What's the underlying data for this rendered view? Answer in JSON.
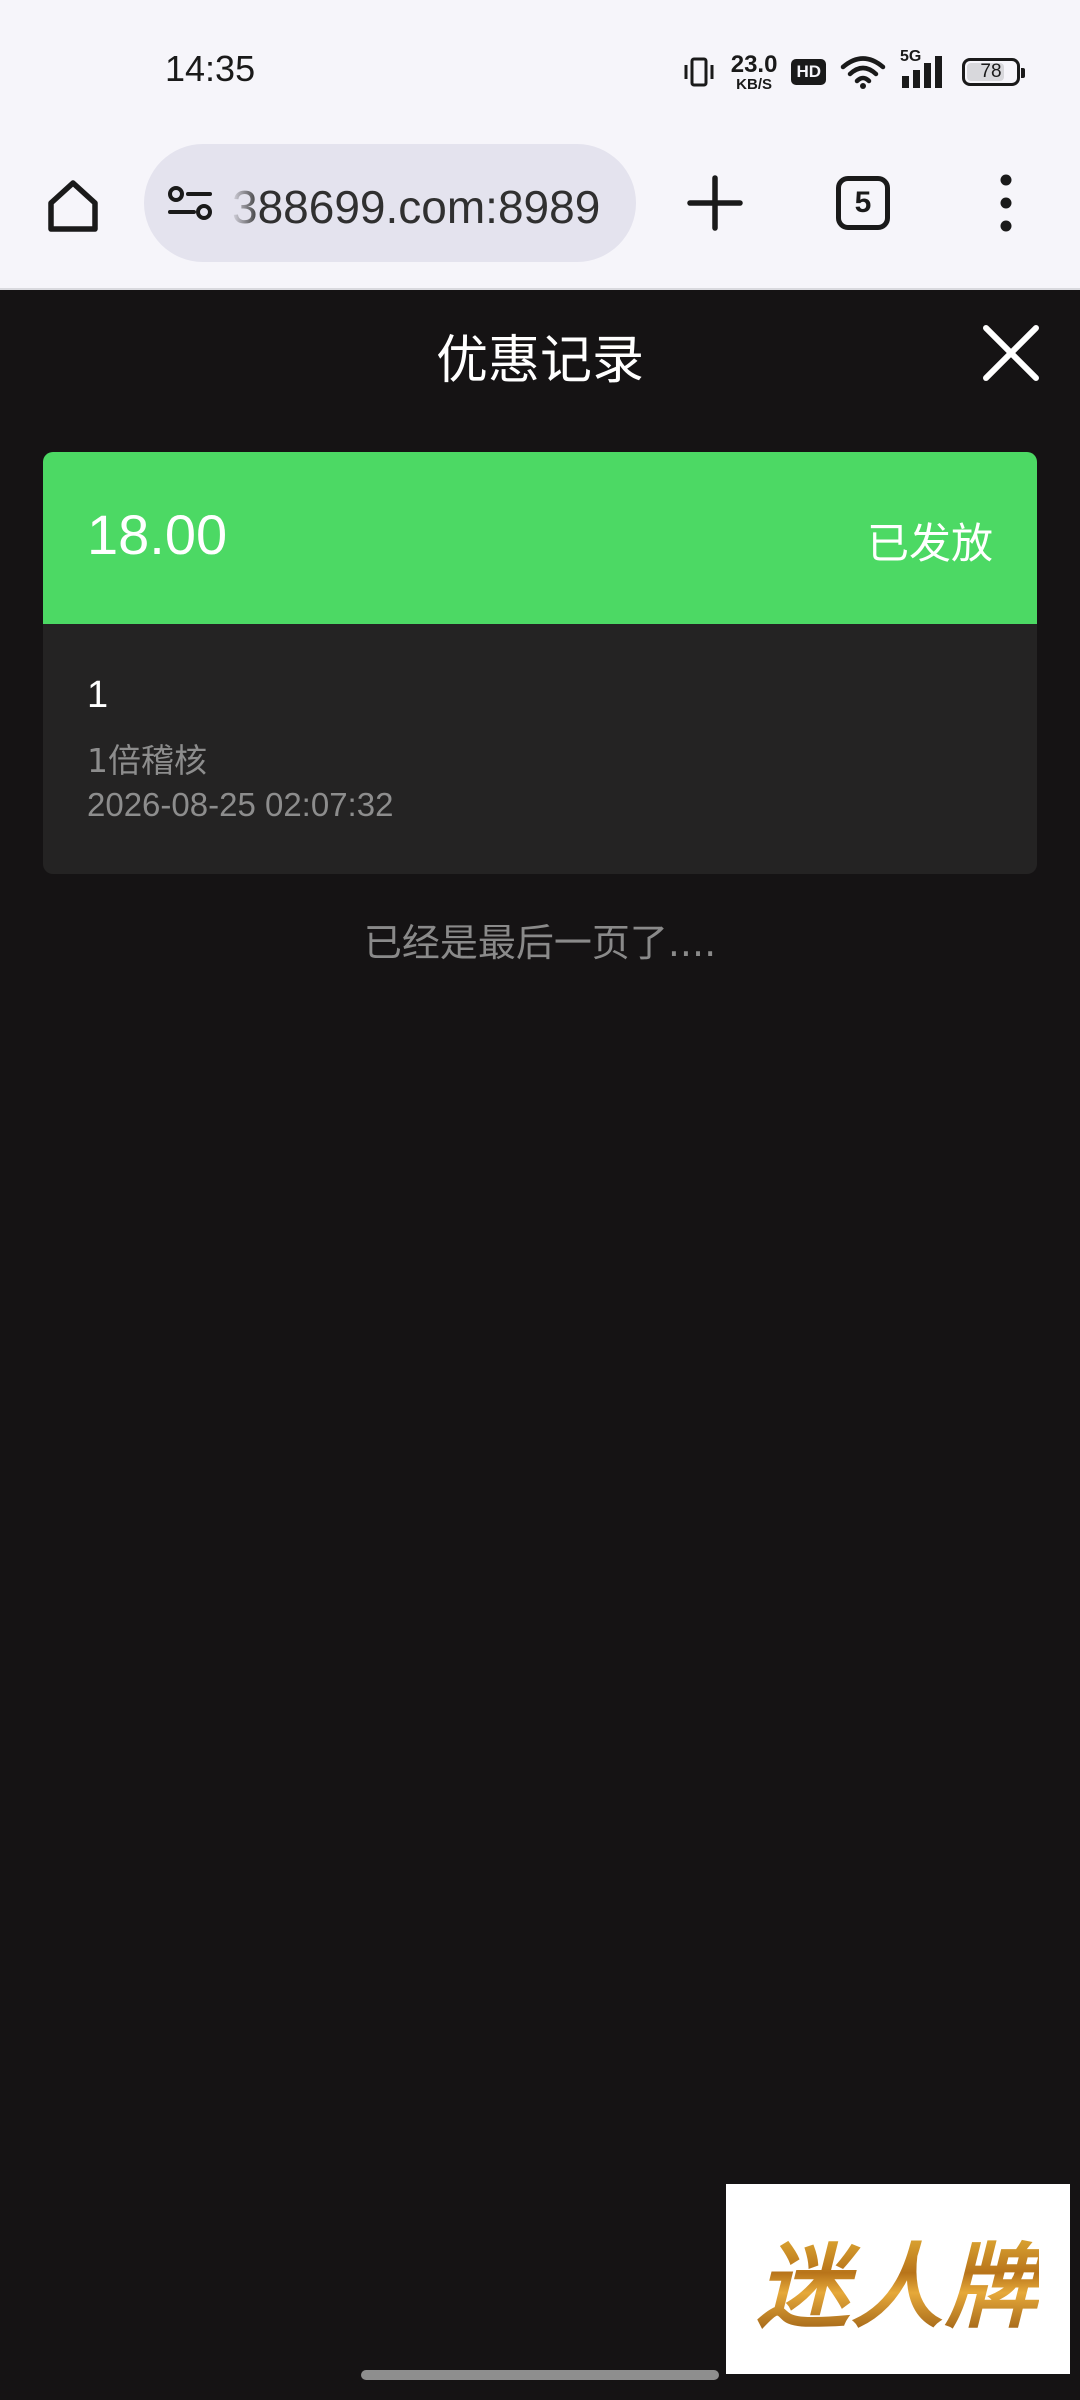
{
  "status_bar": {
    "time": "14:35",
    "net_speed_value": "23.0",
    "net_speed_unit": "KB/S",
    "hd_label": "HD",
    "network_label": "5G",
    "battery_level": "78",
    "battery_fraction": 0.78
  },
  "browser": {
    "url": "388699.com:8989",
    "tab_count": "5"
  },
  "page": {
    "title": "优惠记录",
    "end_text": "已经是最后一页了...."
  },
  "records": [
    {
      "amount": "18.00",
      "status": "已发放",
      "name": "1",
      "description": "1倍稽核",
      "time": "2026-08-25 02:07:32"
    }
  ],
  "watermark": {
    "text": "迷人牌"
  },
  "colors": {
    "accent_green": "#4cd964",
    "background": "#151314",
    "card_background": "#242323"
  }
}
